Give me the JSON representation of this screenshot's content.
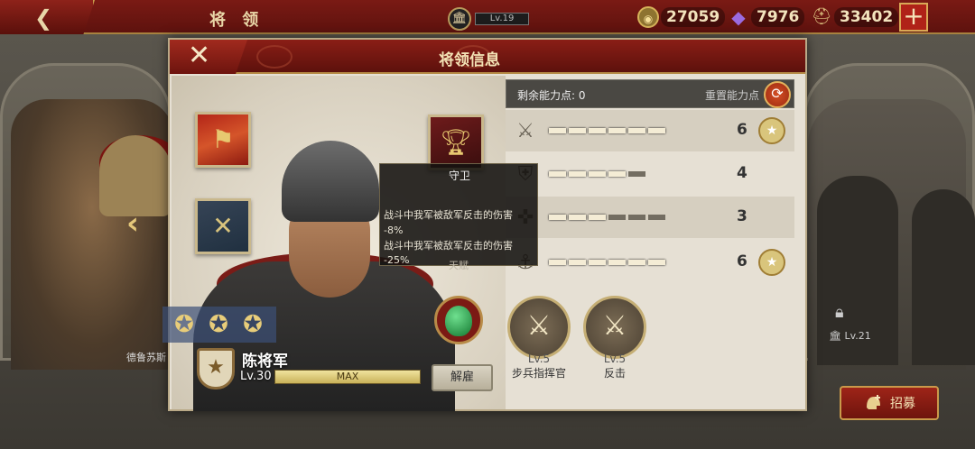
{
  "topbar": {
    "title": "将 领",
    "player_level": "Lv.19",
    "resources": [
      {
        "icon": "coin-icon",
        "value": "27059",
        "color": "#c9a247"
      },
      {
        "icon": "gem-icon",
        "value": "7976",
        "color": "#7b49c9"
      },
      {
        "icon": "helmet-resource-icon",
        "value": "33402",
        "color": "#b99759"
      }
    ],
    "plus_label": "+"
  },
  "panel": {
    "title": "将领信息",
    "close_label": "✕"
  },
  "tooltip": {
    "title": "守卫",
    "line1": "战斗中我军被敌军反击的伤害",
    "line2": "-8%",
    "line3": "战斗中我军被敌军反击的伤害",
    "line4": "-25%",
    "footer": "天赋"
  },
  "general": {
    "name": "陈将军",
    "level": "Lv.30",
    "exp_label": "MAX",
    "dismiss_label": "解雇",
    "star_count": 3
  },
  "stats": {
    "remaining_label": "剩余能力点: 0",
    "reset_label": "重置能力点",
    "rows": [
      {
        "icon": "sword-icon",
        "value": "6",
        "filled": 6,
        "total": 6,
        "medal": true
      },
      {
        "icon": "shield-icon",
        "value": "4",
        "filled": 4,
        "total": 5,
        "medal": false
      },
      {
        "icon": "crossbow-icon",
        "value": "3",
        "filled": 3,
        "total": 6,
        "medal": false
      },
      {
        "icon": "anchor-icon",
        "value": "6",
        "filled": 6,
        "total": 6,
        "medal": true
      }
    ]
  },
  "skills": [
    {
      "level": "Lv.5",
      "name": "步兵指挥官",
      "icon": "crossed-swords-icon"
    },
    {
      "level": "Lv.5",
      "name": "反击",
      "icon": "counterattack-icon"
    }
  ],
  "side": {
    "left_name": "德鲁苏斯",
    "right_level": "Lv.21",
    "recruit_label": "招募"
  }
}
